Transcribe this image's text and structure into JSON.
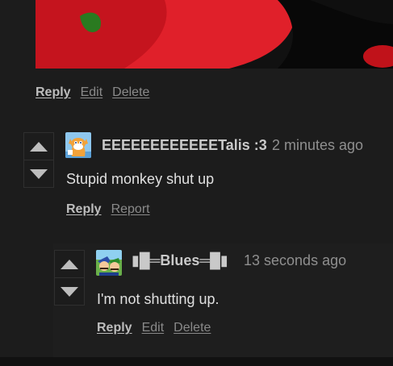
{
  "parent_actions": {
    "reply": "Reply",
    "edit": "Edit",
    "delete": "Delete"
  },
  "comment1": {
    "username": "EEEEEEEEEEEETalis :3",
    "timestamp": "2 minutes ago",
    "body": "Stupid monkey shut up",
    "reply": "Reply",
    "report": "Report",
    "avatar_icon": "tails-fox-avatar-icon"
  },
  "comment2": {
    "username": "▮█═Blues═█▮",
    "timestamp": "13 seconds ago",
    "body": "I'm not shutting up.",
    "reply": "Reply",
    "edit": "Edit",
    "delete": "Delete",
    "avatar_icon": "mario-luigi-avatar-icon"
  },
  "colors": {
    "background": "#1c1c1c",
    "primary_link": "#bdbdbd",
    "secondary_link": "#8a8a8a",
    "timestamp": "#8f8f8f"
  }
}
